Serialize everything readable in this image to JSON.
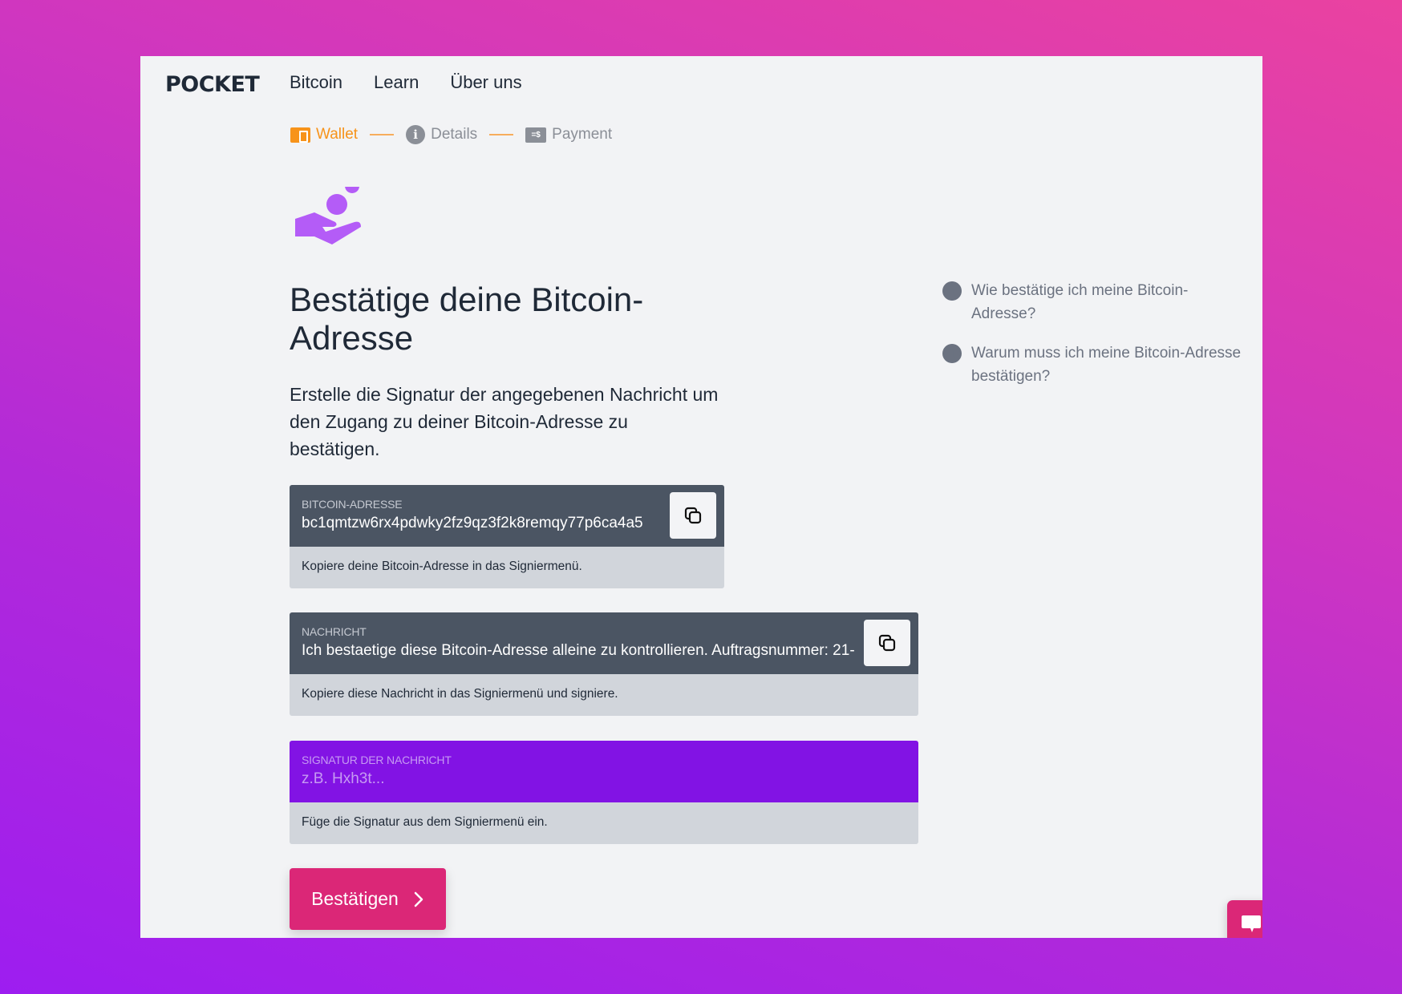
{
  "brand": {
    "logo": "POCKET"
  },
  "nav": {
    "items": [
      {
        "label": "Bitcoin"
      },
      {
        "label": "Learn"
      },
      {
        "label": "Über uns"
      }
    ]
  },
  "stepper": {
    "steps": [
      {
        "label": "Wallet",
        "icon": "wallet-icon",
        "state": "active"
      },
      {
        "label": "Details",
        "icon": "info-icon",
        "state": "inactive"
      },
      {
        "label": "Payment",
        "icon": "payment-icon",
        "state": "inactive"
      }
    ],
    "payment_icon_text": "=$",
    "info_glyph": "i"
  },
  "main": {
    "icon": "hand-coin-icon",
    "title": "Bestätige deine Bitcoin-Adresse",
    "lead": "Erstelle die Signatur der angegebenen Nachricht um den Zugang zu deiner Bitcoin-Adresse zu bestätigen."
  },
  "fields": {
    "address": {
      "label": "Bitcoin-Adresse",
      "value": "bc1qmtzw6rx4pdwky2fz9qz3f2k8remqy77p6ca4a5",
      "hint": "Kopiere deine Bitcoin-Adresse in das Signiermenü."
    },
    "message": {
      "label": "Nachricht",
      "value": "Ich bestaetige diese Bitcoin-Adresse alleine zu kontrollieren. Auftragsnummer: 21-",
      "hint": "Kopiere diese Nachricht in das Signiermenü und signiere."
    },
    "signature": {
      "label": "Signatur der Nachricht",
      "value": "",
      "placeholder": "z.B. Hxh3t...",
      "hint": "Füge die Signatur aus dem Signiermenü ein."
    }
  },
  "actions": {
    "confirm_label": "Bestätigen",
    "confirm_icon": "chevron-right-icon"
  },
  "faq": {
    "items": [
      {
        "label": "Wie bestätige ich meine Bitcoin-Adresse?"
      },
      {
        "label": "Warum muss ich meine Bitcoin-Adresse bestätigen?"
      }
    ]
  },
  "colors": {
    "accent_orange": "#f7931a",
    "primary_pink": "#db2777",
    "signature_purple": "#8213e4",
    "field_dark": "#4b5563",
    "hint_gray": "#d1d5db",
    "hand_icon": "#b45cf7"
  }
}
